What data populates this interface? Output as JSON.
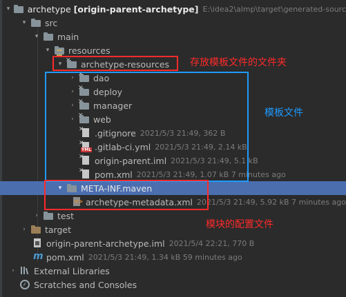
{
  "tree": [
    {
      "arrow": "▾",
      "icon": "folder-icon",
      "name": "archetype",
      "bold_suffix": "[origin-parent-archetype]",
      "meta": "E:\\idea2\\almp\\target\\generated-sourc"
    },
    {
      "arrow": "▾",
      "icon": "folder-icon",
      "name": "src"
    },
    {
      "arrow": "▾",
      "icon": "folder-icon",
      "name": "main"
    },
    {
      "arrow": "▾",
      "icon": "resources-folder-icon",
      "name": "resources"
    },
    {
      "arrow": "▾",
      "icon": "excluded-folder-icon",
      "name": "archetype-resources"
    },
    {
      "arrow": "›",
      "icon": "excluded-folder-icon",
      "name": "dao"
    },
    {
      "arrow": "›",
      "icon": "excluded-folder-icon",
      "name": "deploy"
    },
    {
      "arrow": "›",
      "icon": "excluded-folder-icon",
      "name": "manager"
    },
    {
      "arrow": "›",
      "icon": "excluded-folder-icon",
      "name": "web"
    },
    {
      "arrow": "",
      "icon": "excluded-file-icon",
      "name": ".gitignore",
      "meta": "2021/5/3 21:49, 362 B"
    },
    {
      "arrow": "",
      "icon": "yml-file-icon",
      "name": ".gitlab-ci.yml",
      "meta": "2021/5/3 21:49, 2.14 kB"
    },
    {
      "arrow": "",
      "icon": "excluded-file-icon",
      "name": "origin-parent.iml",
      "meta": "2021/5/3 21:49, 5.1 kB"
    },
    {
      "arrow": "",
      "icon": "excluded-file-icon",
      "name": "pom.xml",
      "meta": "2021/5/3 21:49, 1.07 kB 7 minutes ago"
    },
    {
      "arrow": "▾",
      "icon": "folder-icon",
      "name": "META-INF.maven",
      "selected": true
    },
    {
      "arrow": "",
      "icon": "xml-file-icon",
      "name": "archetype-metadata.xml",
      "meta": "2021/5/3 21:49, 5.92 kB 7 minutes ago"
    },
    {
      "arrow": "›",
      "icon": "folder-icon",
      "name": "test"
    },
    {
      "arrow": "›",
      "icon": "target-folder-icon",
      "name": "target"
    },
    {
      "arrow": "",
      "icon": "iml-file-icon",
      "name": "origin-parent-archetype.iml",
      "meta": "2021/5/4 22:21, 770 B"
    },
    {
      "arrow": "",
      "icon": "maven-file-icon",
      "name": "pom.xml",
      "meta": "2021/5/3 21:49, 1.34 kB 59 minutes ago"
    },
    {
      "arrow": "›",
      "icon": "external-libraries-icon",
      "name": "External Libraries"
    },
    {
      "arrow": "",
      "icon": "scratches-icon",
      "name": "Scratches and Consoles"
    }
  ],
  "annotations": {
    "red_top": "存放模板文件的文件夹",
    "blue": "模板文件",
    "red_bottom": "模块的配置文件"
  },
  "colors": {
    "red": "#ff2a2a",
    "blue": "#1f9bff",
    "selection": "#4b6eaf"
  }
}
